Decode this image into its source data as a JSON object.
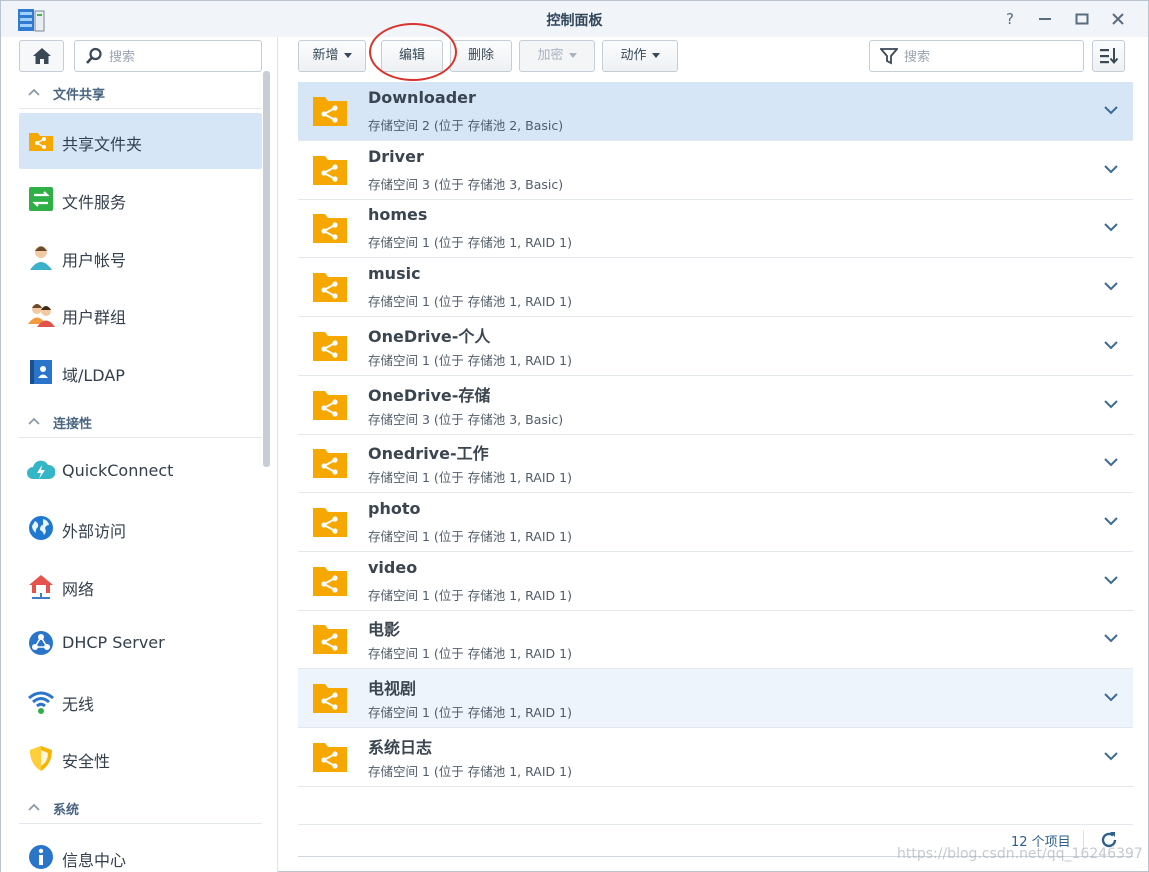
{
  "window": {
    "title": "控制面板"
  },
  "sidebar": {
    "search_placeholder": "搜索",
    "sections": [
      {
        "label": "文件共享"
      },
      {
        "label": "连接性"
      },
      {
        "label": "系统"
      }
    ],
    "items": [
      {
        "label": "共享文件夹",
        "icon": "shared-folder-icon",
        "active": true
      },
      {
        "label": "文件服务",
        "icon": "file-services-icon"
      },
      {
        "label": "用户帐号",
        "icon": "user-icon"
      },
      {
        "label": "用户群组",
        "icon": "group-icon"
      },
      {
        "label": "域/LDAP",
        "icon": "domain-ldap-icon"
      },
      {
        "label": "QuickConnect",
        "icon": "quickconnect-icon"
      },
      {
        "label": "外部访问",
        "icon": "globe-icon"
      },
      {
        "label": "网络",
        "icon": "network-house-icon"
      },
      {
        "label": "DHCP Server",
        "icon": "dhcp-icon"
      },
      {
        "label": "无线",
        "icon": "wifi-icon"
      },
      {
        "label": "安全性",
        "icon": "shield-icon"
      },
      {
        "label": "信息中心",
        "icon": "info-icon"
      }
    ]
  },
  "toolbar": {
    "create_label": "新增",
    "edit_label": "编辑",
    "delete_label": "删除",
    "encrypt_label": "加密",
    "action_label": "动作",
    "filter_placeholder": "搜索"
  },
  "folders": [
    {
      "name": "Downloader",
      "desc": "存储空间 2 (位于 存储池 2, Basic)"
    },
    {
      "name": "Driver",
      "desc": "存储空间 3 (位于 存储池 3, Basic)"
    },
    {
      "name": "homes",
      "desc": "存储空间 1 (位于 存储池 1, RAID 1)"
    },
    {
      "name": "music",
      "desc": "存储空间 1 (位于 存储池 1, RAID 1)"
    },
    {
      "name": "OneDrive-个人",
      "desc": "存储空间 1 (位于 存储池 1, RAID 1)"
    },
    {
      "name": "OneDrive-存储",
      "desc": "存储空间 3 (位于 存储池 3, Basic)"
    },
    {
      "name": "Onedrive-工作",
      "desc": "存储空间 1 (位于 存储池 1, RAID 1)"
    },
    {
      "name": "photo",
      "desc": "存储空间 1 (位于 存储池 1, RAID 1)"
    },
    {
      "name": "video",
      "desc": "存储空间 1 (位于 存储池 1, RAID 1)"
    },
    {
      "name": "电影",
      "desc": "存储空间 1 (位于 存储池 1, RAID 1)"
    },
    {
      "name": "电视剧",
      "desc": "存储空间 1 (位于 存储池 1, RAID 1)"
    },
    {
      "name": "系统日志",
      "desc": "存储空间 1 (位于 存储池 1, RAID 1)"
    }
  ],
  "footer": {
    "count": "12 个项目",
    "watermark": "https://blog.csdn.net/qq_16246397"
  },
  "colors": {
    "accent": "#d6e6f7",
    "folder": "#f7a800",
    "ring": "#d9332e"
  }
}
